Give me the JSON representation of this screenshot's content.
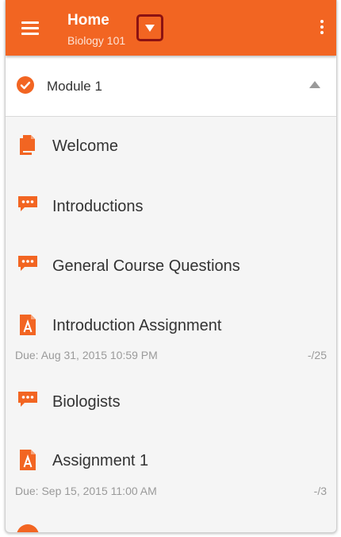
{
  "header": {
    "title": "Home",
    "subtitle": "Biology 101",
    "accent_color": "#f26522",
    "icons": [
      "hamburger-menu-icon",
      "dropdown-triangle-icon",
      "more-vert-icon"
    ]
  },
  "module": {
    "title": "Module 1",
    "status": "completed",
    "icons": [
      "checkmark-circle-icon",
      "collapse-triangle-icon"
    ]
  },
  "items": [
    {
      "type": "page",
      "icon": "page-icon",
      "label": "Welcome"
    },
    {
      "type": "discussion",
      "icon": "discussion-icon",
      "label": "Introductions"
    },
    {
      "type": "discussion",
      "icon": "discussion-icon",
      "label": "General Course Questions"
    },
    {
      "type": "assignment",
      "icon": "assignment-icon",
      "label": "Introduction Assignment",
      "due": "Due: Aug 31, 2015 10:59 PM",
      "points": "-/25"
    },
    {
      "type": "discussion",
      "icon": "discussion-icon",
      "label": "Biologists"
    },
    {
      "type": "assignment",
      "icon": "assignment-icon",
      "label": "Assignment 1",
      "due": "Due: Sep 15, 2015 11:00 AM",
      "points": "-/3"
    }
  ]
}
